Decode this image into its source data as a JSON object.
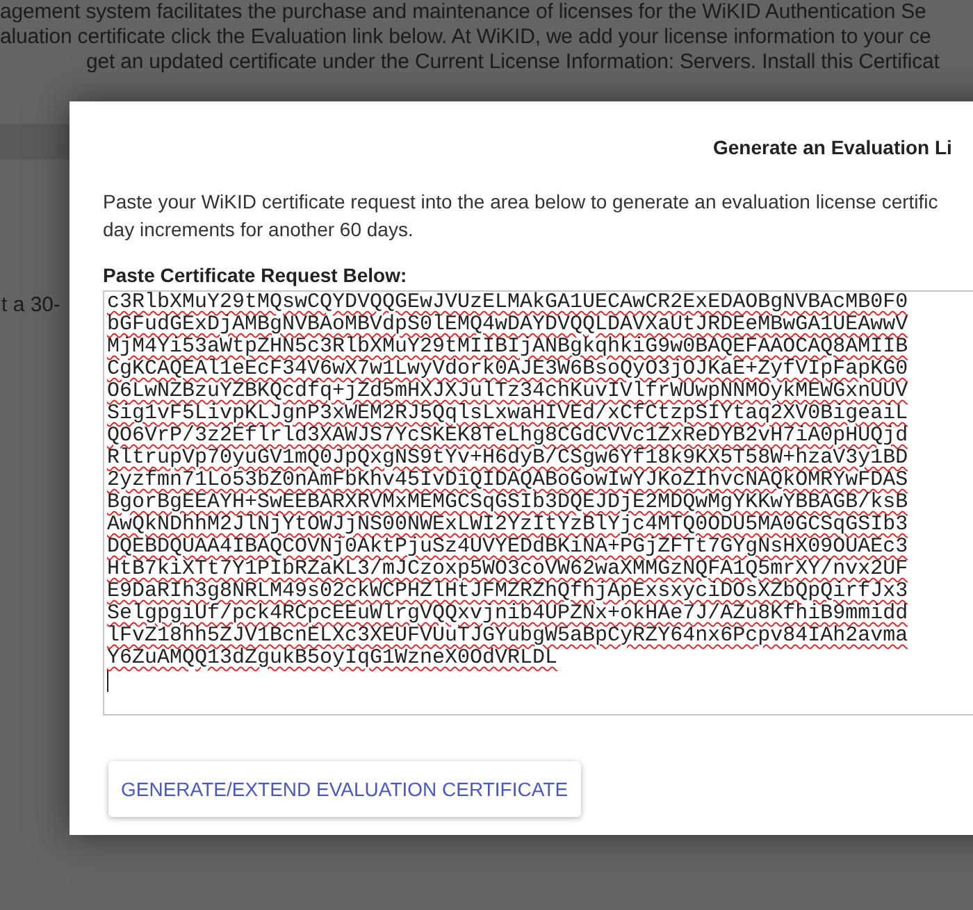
{
  "background_page": {
    "intro_lines": [
      "agement system facilitates the purchase and maintenance of licenses for the WiKID Authentication Se",
      "aluation certificate click the Evaluation link below. At WiKID, we add your license information to your ce",
      "get an updated certificate under the Current License Information: Servers. Install this Certificat"
    ],
    "side_text": "t a 30-"
  },
  "dialog": {
    "title": "Generate an Evaluation Li",
    "paragraph_lines": [
      "Paste your WiKID certificate request into the area below to generate an evaluation license certific",
      "day increments for another 60 days."
    ],
    "field_label": "Paste Certificate Request Below:",
    "request_lines": [
      "c3RlbXMuY29tMQswCQYDVQQGEwJVUzELMAkGA1UECAwCR2ExEDAOBgNVBAcMB0F0",
      "bGFudGExDjAMBgNVBAoMBVdpS0lEMQ4wDAYDVQQLDAVXaUtJRDEeMBwGA1UEAwwV",
      "MjM4Yi53aWtpZHN5c3RlbXMuY29tMIIBIjANBgkqhkiG9w0BAQEFAAOCAQ8AMIIB",
      "CgKCAQEAl1eEcF34V6wX7w1LwyVdork0AJE3W6BsoQyO3jOJKaE+ZyfVIpFapKG0",
      "O6LwNZBzuYZBKQcdfq+jZd5mHXJXJulTz34chKuvIVlfrWUwpNNMOykMEWGxnUUV",
      "Sig1vF5LivpKLJgnP3xWEM2RJ5QqlsLxwaHIVEd/xCfCtzpSIYtaq2XV0BigeaiL",
      "QO6VrP/3z2Eflrld3XAWJS7YcSKEK8TeLhg8CGdCVVc1ZxReDYB2vH7iA0pHUQjd",
      "RltrupVp70yuGV1mQ0JpQxgNS9tYv+H6dyB/CSgw6Yf18k9KX5T58W+hzaV3y1BD",
      "2yzfmn71Lo53bZ0nAmFbKhv45IvDiQIDAQABoGowIwYJKoZIhvcNAQkOMRYwFDAS",
      "BgorBgEEAYH+SwEEBARXRVMxMEMGCSqGSIb3DQEJDjE2MDQwMgYKKwYBBAGB/ksB",
      "AwQkNDhhM2JlNjYtOWJjNS00NWExLWI2YzItYzBlYjc4MTQ0ODU5MA0GCSqGSIb3",
      "DQEBDQUAA4IBAQCOVNj0AktPjuSz4UVYEDdBKiNA+PGjZFTt7GYgNsHX09OUAEc3",
      "HtB7kiXTt7Y1PIbRZaKL3/mJCzoxp5WO3coVW62waXMMGzNQFA1Q5mrXY/nvx2UF",
      "E9DaRIh3g8NRLM49s02ckWCPHZlHtJFMZRZhQfhjApExsxyciDOsXZbQpQirfJx3",
      "SelgpgiUf/pck4RCpcEEuWlrgVQQxvjnib4UPZNx+okHAe7J/AZu8KfhiB9mmidd",
      "lFvZ18hh5ZJV1BcnELXc3XEUFVUuTJGYubgW5aBpCyRZY64nx6Pcpv84IAh2avma",
      "Y6ZuAMQQ13dZgukB5oyIqG1WzneX0OdVRLDL"
    ],
    "button": "GENERATE/EXTEND EVALUATION CERTIFICATE"
  }
}
